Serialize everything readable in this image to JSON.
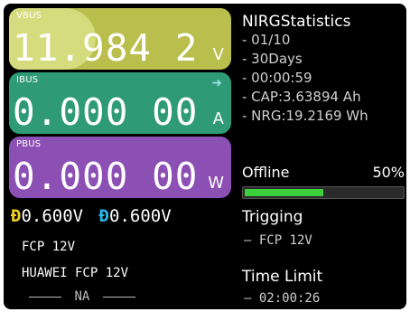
{
  "vbus": {
    "label": "VBUS",
    "value": "11.984 2",
    "unit": "V"
  },
  "ibus": {
    "label": "IBUS",
    "value": "0.000 00",
    "unit": "A",
    "direction_icon": "arrow-right-icon"
  },
  "pbus": {
    "label": "PBUS",
    "value": "0.000 00",
    "unit": "W"
  },
  "data_lines": {
    "dplus_icon": "d-plus-icon",
    "dplus_value": "0.600V",
    "dminus_icon": "d-minus-icon",
    "dminus_value": "0.600V"
  },
  "protocol": {
    "primary": "FCP 12V",
    "device": "HUAWEI FCP 12V",
    "status": "NA"
  },
  "stats": {
    "title": "NIRGStatistics",
    "lines": [
      "- 01/10",
      "- 30Days",
      "- 00:00:59",
      "- CAP:3.63894 Ah",
      "- NRG:19.2169 Wh"
    ]
  },
  "status": {
    "label": "Offline",
    "percent_text": "50%",
    "progress": 0.5,
    "bar_color": "#3bd03b"
  },
  "trigging": {
    "title": "Trigging",
    "value": "— FCP 12V"
  },
  "time_limit": {
    "title": "Time Limit",
    "value": "— 02:00:26"
  },
  "colors": {
    "vbus": "#b9be4c",
    "ibus": "#2f9a76",
    "pbus": "#8c4fb4",
    "dplus": "#f0d21a",
    "dminus": "#22b8e8"
  }
}
